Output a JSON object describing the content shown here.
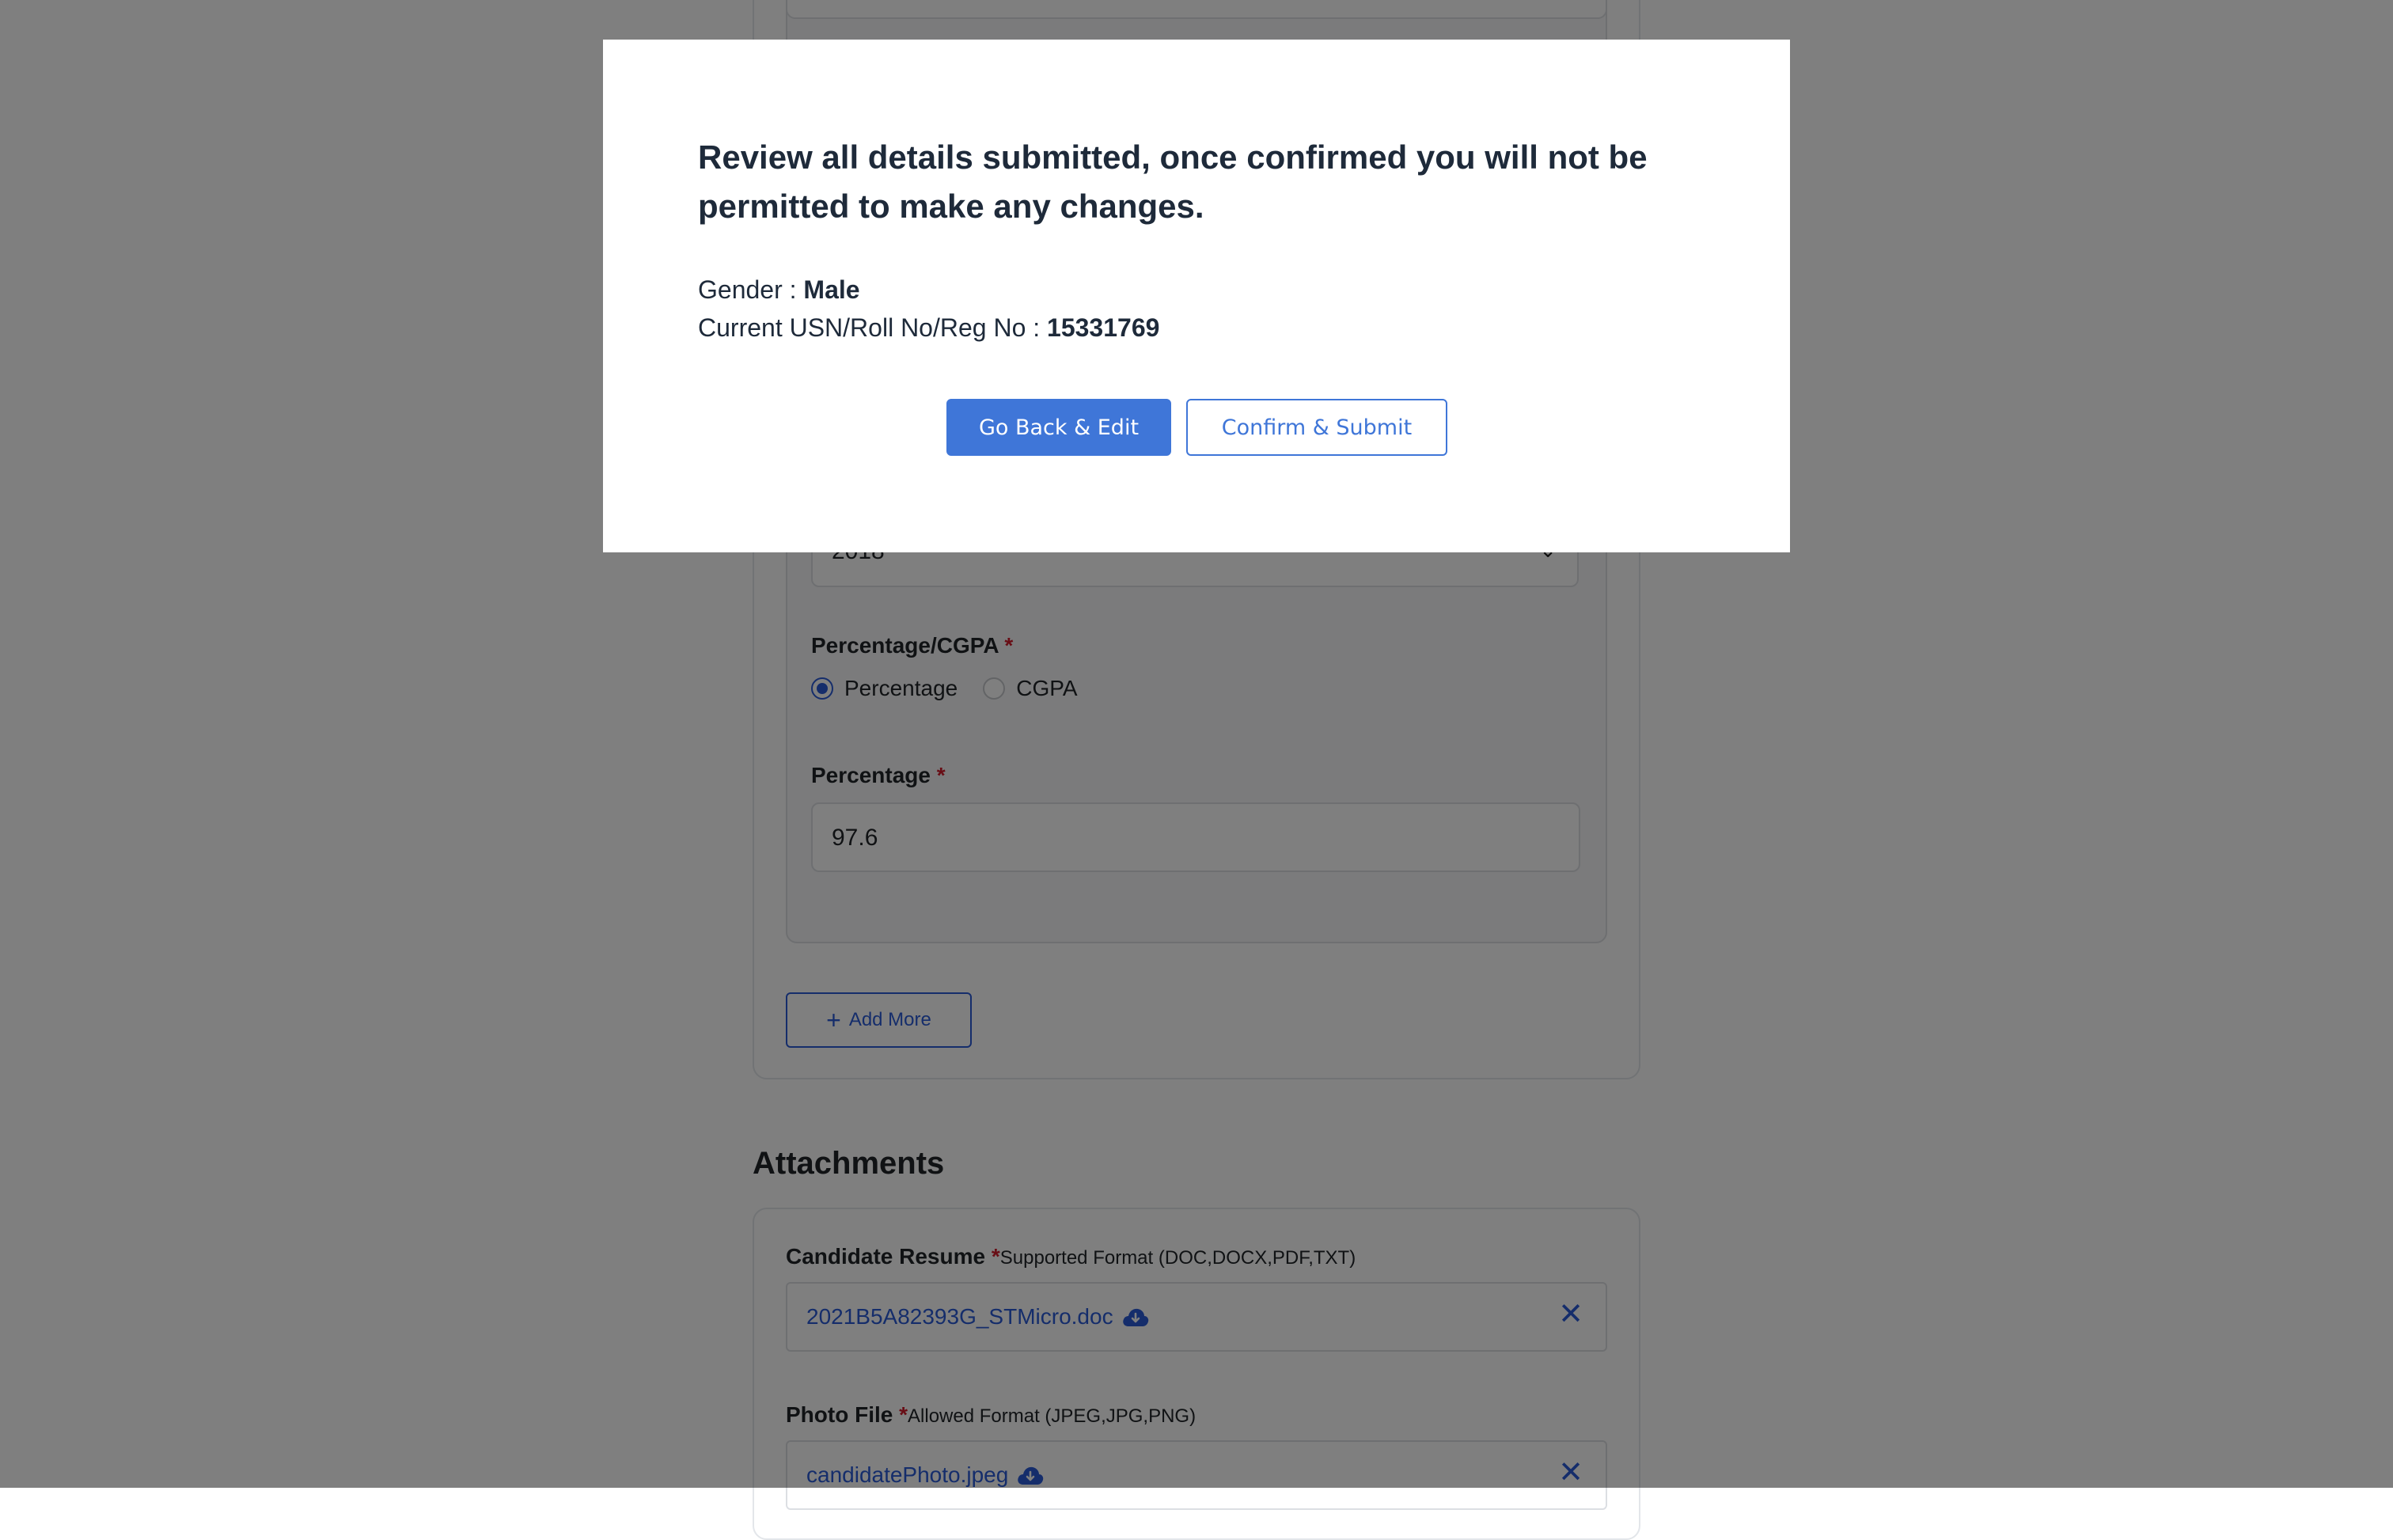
{
  "form": {
    "year_value": "2018",
    "percentage_cgpa_label": "Percentage/CGPA",
    "required_mark": "*",
    "radio_percentage_label": "Percentage",
    "radio_cgpa_label": "CGPA",
    "radio_selected": "Percentage",
    "percentage_label": "Percentage",
    "percentage_value": "97.6",
    "add_more_label": "Add More"
  },
  "attachments": {
    "title": "Attachments",
    "resume_label": "Candidate Resume",
    "resume_hint": "Supported Format (DOC,DOCX,PDF,TXT)",
    "resume_file": "2021B5A82393G_STMicro.doc",
    "photo_label": "Photo File",
    "photo_hint": "Allowed Format (JPEG,JPG,PNG)",
    "photo_file": "candidatePhoto.jpeg"
  },
  "modal": {
    "title": "Review all details submitted, once confirmed you will not be permitted to make any changes.",
    "gender_label": "Gender : ",
    "gender_value": "Male",
    "usn_label": "Current USN/Roll No/Reg No : ",
    "usn_value": "15331769",
    "go_back_label": "Go Back & Edit",
    "confirm_label": "Confirm & Submit"
  },
  "icons": {
    "download": "cloud-download-icon",
    "remove": "close-icon",
    "add": "plus-icon",
    "dropdown": "chevron-down-icon"
  },
  "colors": {
    "accent": "#2a5bd7",
    "primary_button": "#3f76d8",
    "required": "#d11a2a",
    "overlay": "rgba(0,0,0,0.5)"
  }
}
